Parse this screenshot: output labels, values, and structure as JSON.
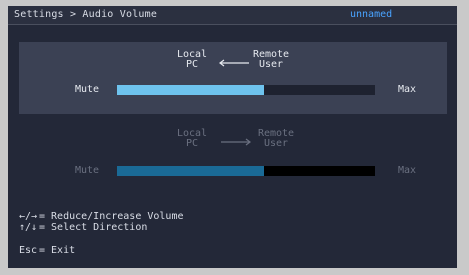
{
  "header": {
    "breadcrumb": "Settings > Audio Volume",
    "user_name": "unnamed"
  },
  "direction_local_to_pc": {
    "left_label": "Local\nPC",
    "right_label": "Remote\nUser",
    "mute_label": "Mute",
    "max_label": "Max",
    "level_percent": 57,
    "active": true,
    "fill_color": "#6ec3ee"
  },
  "direction_to_remote": {
    "left_label": "Local\nPC",
    "right_label": "Remote\nUser",
    "mute_label": "Mute",
    "max_label": "Max",
    "level_percent": 57,
    "active": false,
    "fill_color": "#1a6a96"
  },
  "help": {
    "adjust_keys": "←/→",
    "adjust_text": "= Reduce/Increase Volume",
    "select_keys": "↑/↓",
    "select_text": "= Select Direction",
    "exit_key": "Esc",
    "exit_text": "= Exit"
  }
}
